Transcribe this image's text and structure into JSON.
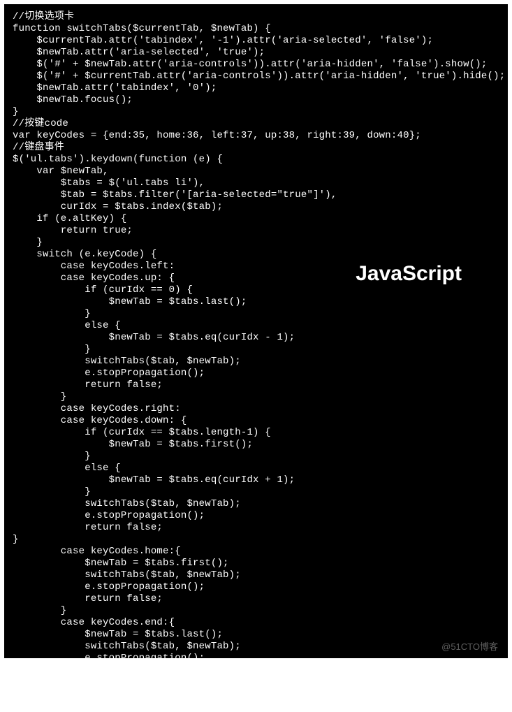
{
  "code": "//切换选项卡\nfunction switchTabs($currentTab, $newTab) {\n    $currentTab.attr('tabindex', '-1').attr('aria-selected', 'false');\n    $newTab.attr('aria-selected', 'true');\n    $('#' + $newTab.attr('aria-controls')).attr('aria-hidden', 'false').show();\n    $('#' + $currentTab.attr('aria-controls')).attr('aria-hidden', 'true').hide();\n    $newTab.attr('tabindex', '0');\n    $newTab.focus();\n}\n//按键code\nvar keyCodes = {end:35, home:36, left:37, up:38, right:39, down:40};\n//键盘事件\n$('ul.tabs').keydown(function (e) {\n    var $newTab,\n        $tabs = $('ul.tabs li'),\n        $tab = $tabs.filter('[aria-selected=\"true\"]'),\n        curIdx = $tabs.index($tab);\n    if (e.altKey) {\n        return true;\n    }\n    switch (e.keyCode) {\n        case keyCodes.left:\n        case keyCodes.up: {\n            if (curIdx == 0) {\n                $newTab = $tabs.last();\n            }\n            else {\n                $newTab = $tabs.eq(curIdx - 1);\n            }\n            switchTabs($tab, $newTab);\n            e.stopPropagation();\n            return false;\n        }\n        case keyCodes.right:\n        case keyCodes.down: {\n            if (curIdx == $tabs.length-1) {\n                $newTab = $tabs.first();\n            }\n            else {\n                $newTab = $tabs.eq(curIdx + 1);\n            }\n            switchTabs($tab, $newTab);\n            e.stopPropagation();\n            return false;\n}\n        case keyCodes.home:{\n            $newTab = $tabs.first();\n            switchTabs($tab, $newTab);\n            e.stopPropagation();\n            return false;\n        }\n        case keyCodes.end:{\n            $newTab = $tabs.last();\n            switchTabs($tab, $newTab);\n            e.stopPropagation();\n            return false;\n        }\n    }\n});",
  "badge_label": "JavaScript",
  "watermark": "@51CTO博客"
}
